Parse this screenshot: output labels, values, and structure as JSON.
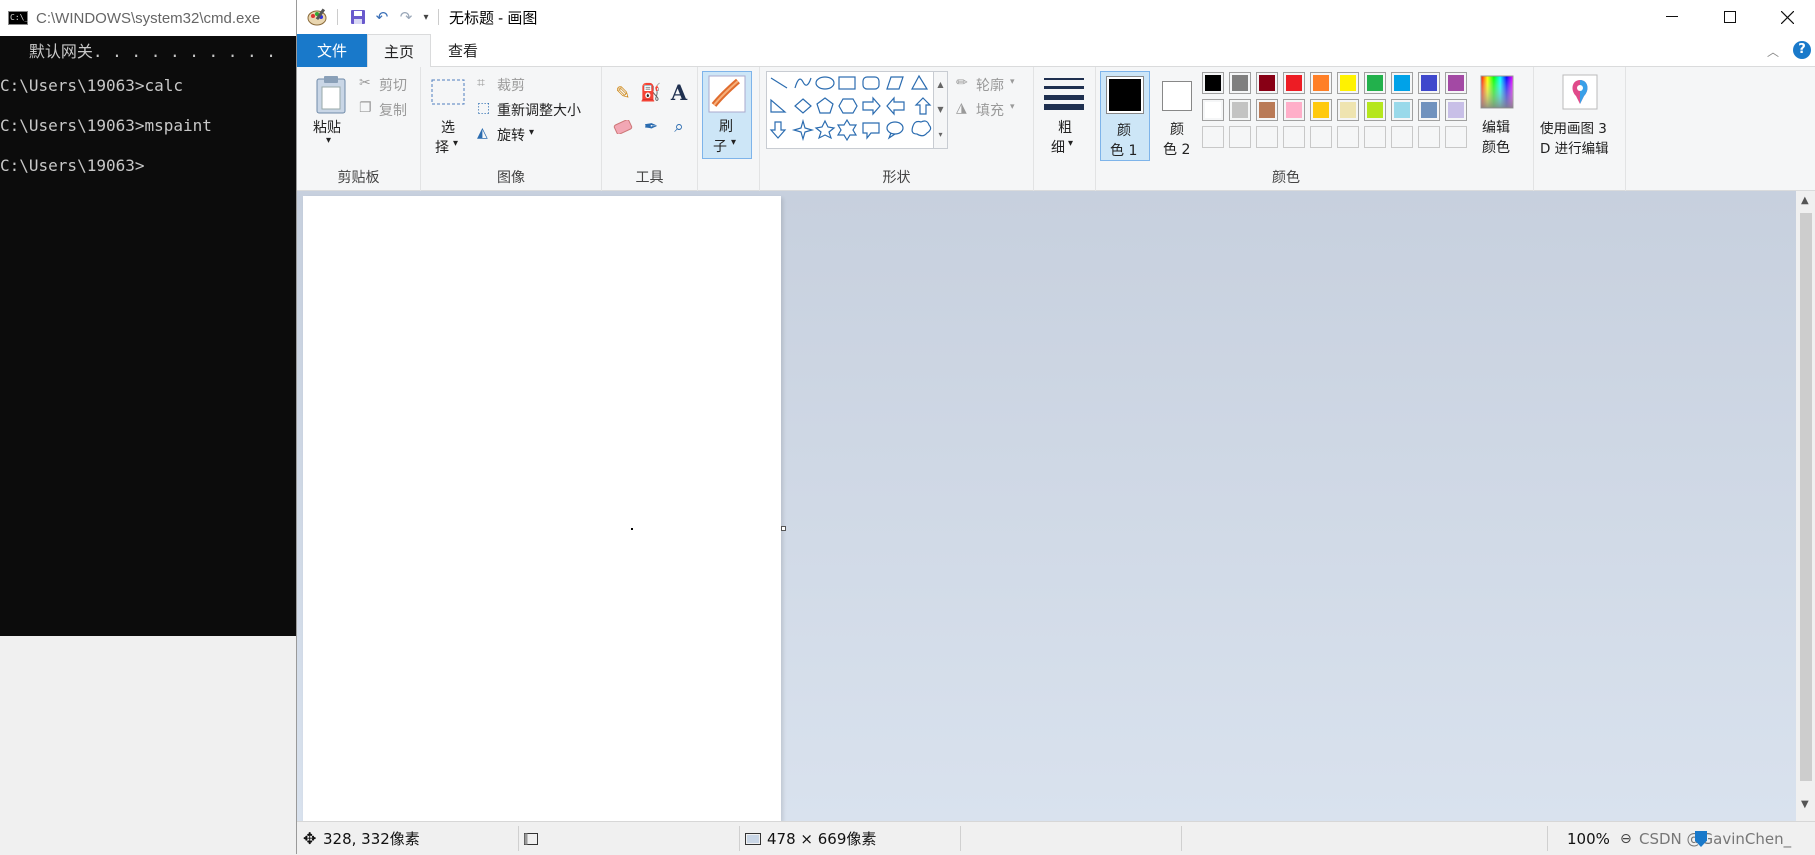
{
  "cmd": {
    "title": "C:\\WINDOWS\\system32\\cmd.exe",
    "lines": [
      "   默认网关. . . . . . . . . .",
      "C:\\Users\\19063>calc",
      "C:\\Users\\19063>mspaint",
      "C:\\Users\\19063>"
    ]
  },
  "paint": {
    "window_title": "无标题 - 画图",
    "tabs": {
      "file": "文件",
      "home": "主页",
      "view": "查看"
    },
    "clipboard": {
      "paste": "粘贴",
      "cut": "剪切",
      "copy": "复制",
      "group": "剪贴板"
    },
    "image": {
      "select_1": "选",
      "select_2": "择",
      "crop": "裁剪",
      "resize": "重新调整大小",
      "rotate": "旋转",
      "group": "图像"
    },
    "tools": {
      "group": "工具"
    },
    "brushes": {
      "label_1": "刷",
      "label_2": "子"
    },
    "shapes": {
      "outline": "轮廓",
      "fill": "填充",
      "group": "形状"
    },
    "size": {
      "label_1": "粗",
      "label_2": "细"
    },
    "colors": {
      "color1_1": "颜",
      "color1_2": "色 1",
      "color2_1": "颜",
      "color2_2": "色 2",
      "edit_1": "编辑",
      "edit_2": "颜色",
      "group": "颜色",
      "color1_value": "#000000",
      "color2_value": "#ffffff",
      "palette_row1": [
        "#000000",
        "#7f7f7f",
        "#880015",
        "#ed1c24",
        "#ff7f27",
        "#fff200",
        "#22b14c",
        "#00a2e8",
        "#3f48cc",
        "#a349a4"
      ],
      "palette_row2": [
        "#ffffff",
        "#c3c3c3",
        "#b97a57",
        "#ffaec9",
        "#ffc90e",
        "#efe4b0",
        "#b5e61d",
        "#99d9ea",
        "#7092be",
        "#c8bfe7"
      ]
    },
    "paint3d": {
      "label_1": "使用画图 3",
      "label_2": "D 进行编辑"
    },
    "status": {
      "cursor_pos": "328, 332像素",
      "canvas_size": "478 × 669像素",
      "zoom": "100%",
      "watermark": "CSDN @GavinChen_"
    }
  }
}
